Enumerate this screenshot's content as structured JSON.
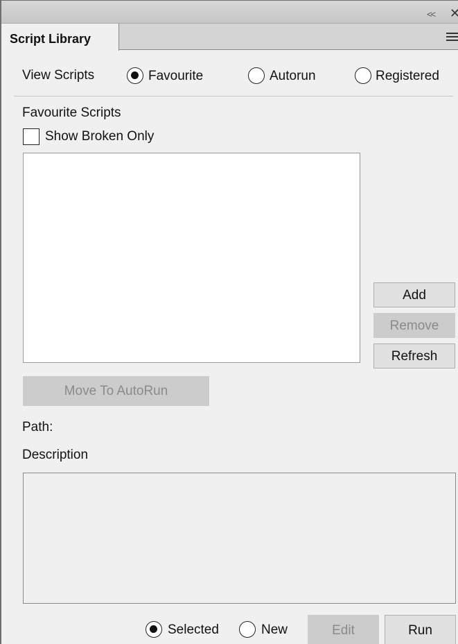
{
  "titlebar": {
    "collapse_glyph": "<<",
    "close_glyph": "✕"
  },
  "tab": {
    "label": "Script Library",
    "menu_icon": "hamburger-menu-icon"
  },
  "view": {
    "label": "View Scripts",
    "options": [
      {
        "label": "Favourite",
        "selected": true
      },
      {
        "label": "Autorun",
        "selected": false
      },
      {
        "label": "Registered",
        "selected": false
      }
    ]
  },
  "section": {
    "title": "Favourite Scripts",
    "show_broken_label": "Show Broken Only",
    "show_broken_checked": false,
    "items": []
  },
  "buttons": {
    "add": "Add",
    "remove": "Remove",
    "refresh": "Refresh",
    "move_to_autorun": "Move To AutoRun",
    "edit": "Edit",
    "run": "Run"
  },
  "details": {
    "path_label": "Path:",
    "description_label": "Description"
  },
  "footer": {
    "options": [
      {
        "label": "Selected",
        "selected": true
      },
      {
        "label": "New",
        "selected": false
      }
    ]
  }
}
